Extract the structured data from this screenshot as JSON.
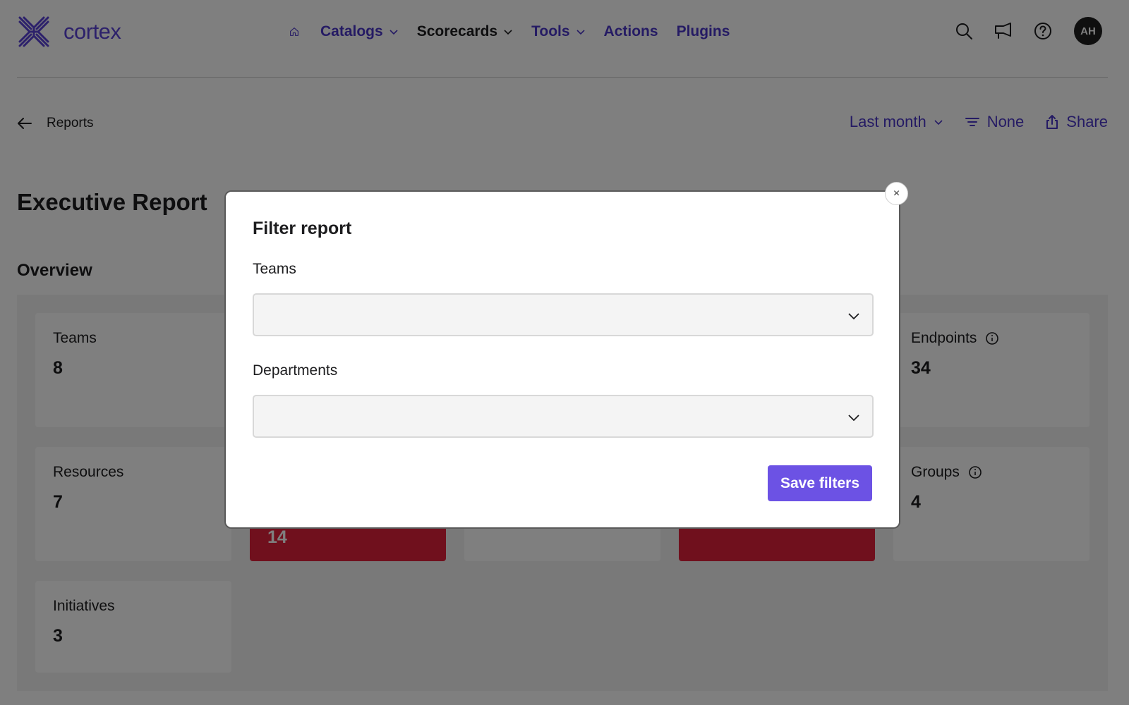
{
  "brand": {
    "name": "cortex",
    "color": "#5b43d6"
  },
  "nav": {
    "items": [
      {
        "label": "Catalogs",
        "has_dropdown": true,
        "color": "#4a36c9"
      },
      {
        "label": "Scorecards",
        "has_dropdown": true,
        "color": "#1d1d1f"
      },
      {
        "label": "Tools",
        "has_dropdown": true,
        "color": "#4a36c9"
      },
      {
        "label": "Actions",
        "has_dropdown": false,
        "color": "#4a36c9"
      },
      {
        "label": "Plugins",
        "has_dropdown": false,
        "color": "#4a36c9"
      }
    ],
    "icons": [
      "home-icon",
      "search-icon",
      "announcements-icon",
      "help-icon"
    ],
    "avatar_initials": "AH"
  },
  "subbar": {
    "back_label": "Reports",
    "date_range": "Last month",
    "filter_label": "None",
    "share_label": "Share"
  },
  "page": {
    "title": "Executive Report",
    "section_title": "Overview"
  },
  "overview": {
    "cards": [
      {
        "label": "Teams",
        "value": "8",
        "info": false,
        "highlight": false
      },
      {
        "label": "Endpoints",
        "value": "34",
        "info": true,
        "highlight": false
      },
      {
        "label": "Resources",
        "value": "7",
        "info": false,
        "highlight": false
      },
      {
        "label": "",
        "value": "14",
        "info": false,
        "highlight": true
      },
      {
        "label": "",
        "value": "",
        "info": false,
        "highlight": false
      },
      {
        "label": "",
        "value": "",
        "info": false,
        "highlight": true
      },
      {
        "label": "Groups",
        "value": "4",
        "info": true,
        "highlight": false
      },
      {
        "label": "Initiatives",
        "value": "3",
        "info": false,
        "highlight": false
      }
    ]
  },
  "modal": {
    "title": "Filter report",
    "teams_label": "Teams",
    "teams_value": "",
    "departments_label": "Departments",
    "departments_value": "",
    "save_label": "Save filters",
    "close_glyph": "×",
    "accent": "#6c52e4"
  }
}
